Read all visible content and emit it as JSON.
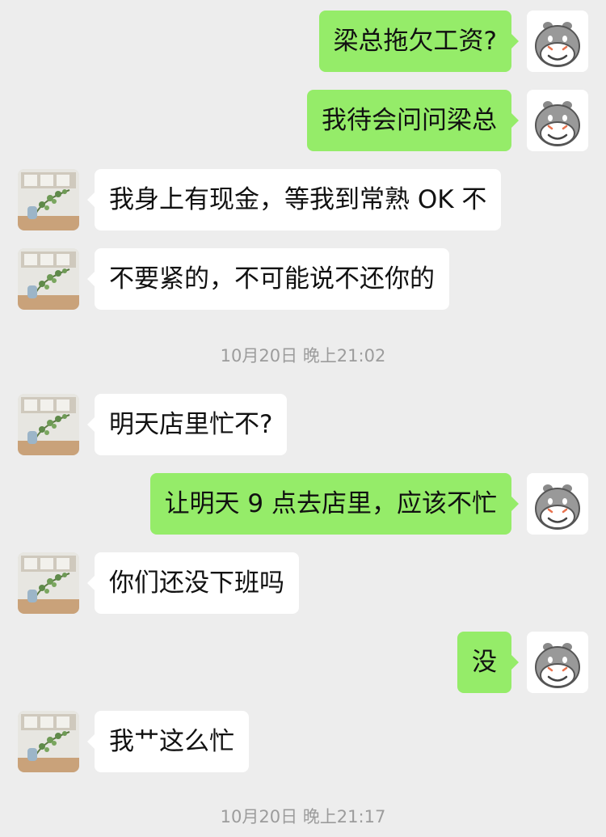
{
  "messages": [
    {
      "side": "self",
      "text": "梁总拖欠工资?"
    },
    {
      "side": "self",
      "text": "我待会问问梁总"
    },
    {
      "side": "other",
      "text": "我身上有现金，等我到常熟 OK 不"
    },
    {
      "side": "other",
      "text": "不要紧的，不可能说不还你的"
    },
    {
      "side": "other",
      "text": "明天店里忙不?"
    },
    {
      "side": "self",
      "text": "让明天 9 点去店里，应该不忙"
    },
    {
      "side": "other",
      "text": "你们还没下班吗"
    },
    {
      "side": "self",
      "text": "没"
    },
    {
      "side": "other",
      "text": "我艹这么忙"
    }
  ],
  "timestamps": [
    "10月20日 晚上21:02",
    "10月20日 晚上21:17"
  ],
  "avatars": {
    "self": "hippo-avatar-icon",
    "other": "plant-photo-avatar"
  },
  "colors": {
    "sent_bubble": "#95ec69",
    "recv_bubble": "#ffffff",
    "background": "#ededed",
    "timestamp": "#9c9c9c"
  }
}
